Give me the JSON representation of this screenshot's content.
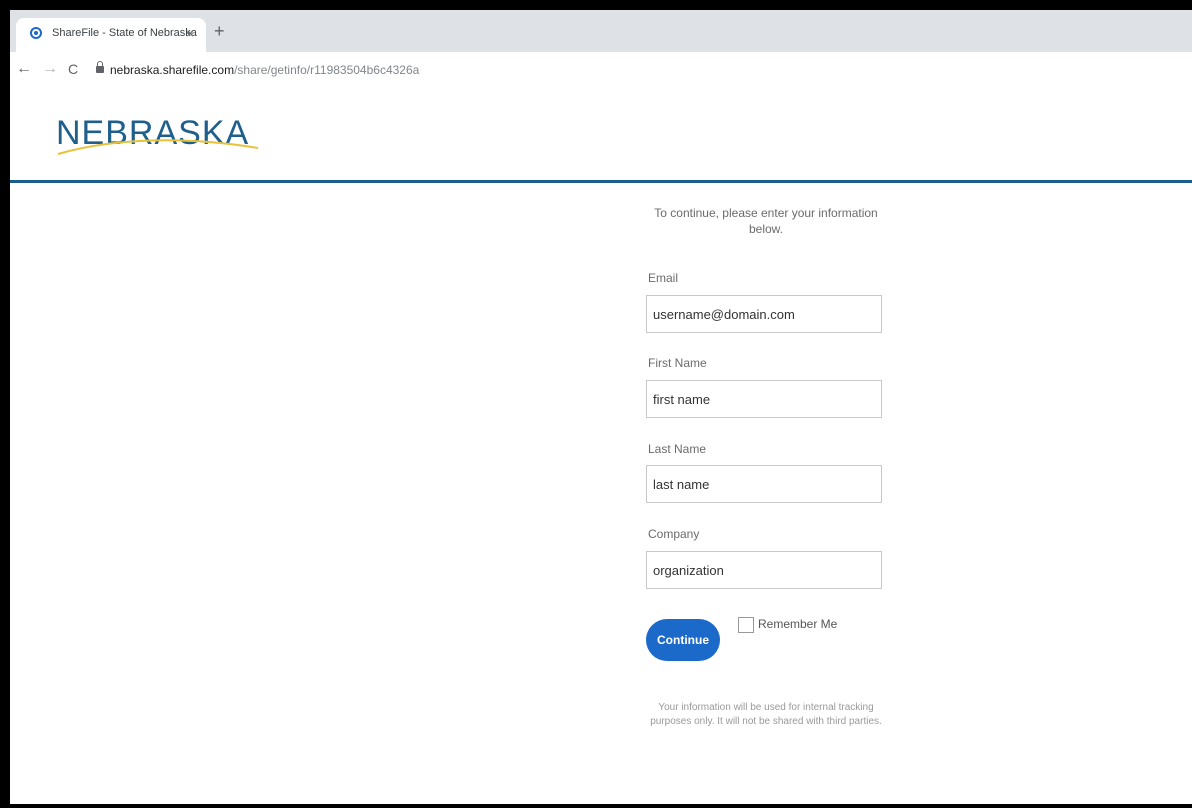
{
  "browser": {
    "tab_title": "ShareFile - State of Nebraska",
    "tab_close": "×",
    "new_tab": "+",
    "back": "←",
    "forward": "→",
    "reload": "C",
    "url_host": "nebraska.sharefile.com",
    "url_path": "/share/getinfo/r11983504b6c4326a"
  },
  "header": {
    "logo_text": "NEBRASKA",
    "brand_color": "#1f5f8b",
    "swoosh_color": "#e8c23a"
  },
  "form": {
    "intro": "To continue, please enter your information below.",
    "email_label": "Email",
    "email_value": "username@domain.com",
    "first_name_label": "First Name",
    "first_name_value": "first name",
    "last_name_label": "Last Name",
    "last_name_value": "last name",
    "company_label": "Company",
    "company_value": "organization",
    "continue_label": "Continue",
    "remember_label": "Remember Me",
    "remember_checked": false,
    "footnote": "Your information will be used for internal tracking purposes only. It will not be shared with third parties."
  },
  "colors": {
    "accent": "#1b6ac9",
    "header_rule": "#1b5c8a"
  }
}
